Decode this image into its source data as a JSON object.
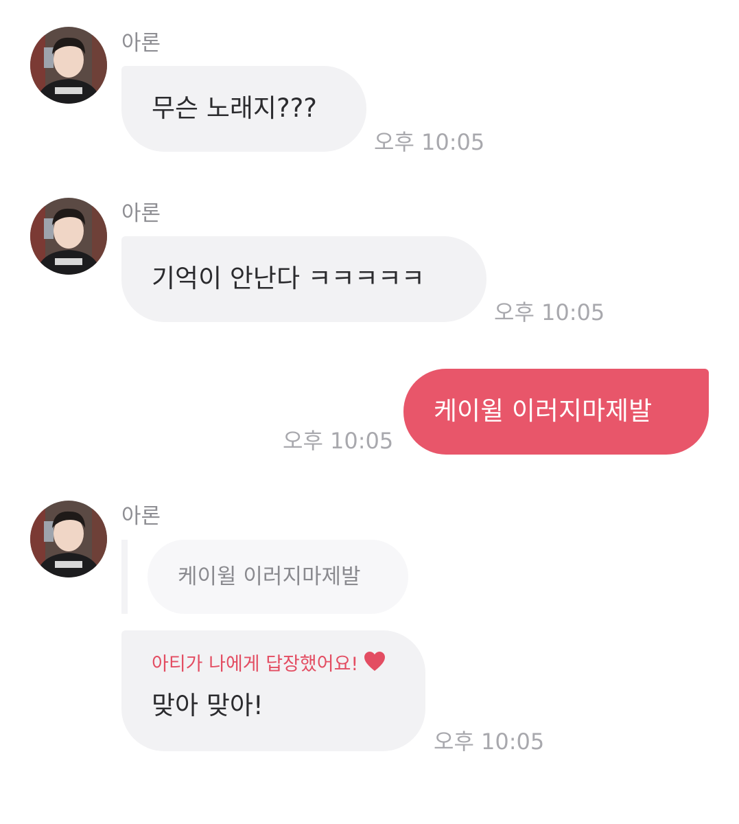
{
  "messages": [
    {
      "sender": "아론",
      "text": "무슨 노래지???",
      "time": "오후 10:05"
    },
    {
      "sender": "아론",
      "text": "기억이 안난다 ㅋㅋㅋㅋㅋ",
      "time": "오후 10:05"
    },
    {
      "text": "케이윌 이러지마제발",
      "time": "오후 10:05"
    },
    {
      "sender": "아론",
      "quoted_text": "케이윌 이러지마제발",
      "reply_note": "아티가 나에게 답장했어요!",
      "text": "맞아 맞아!",
      "time": "오후 10:05"
    }
  ],
  "colors": {
    "incoming_bubble": "#f2f2f4",
    "outgoing_bubble": "#e8566a",
    "reply_note": "#e34d62",
    "timestamp": "#a8a8ad",
    "sender_name": "#8e8e93"
  },
  "icons": {
    "avatar": "avatar",
    "heart": "heart-icon"
  }
}
